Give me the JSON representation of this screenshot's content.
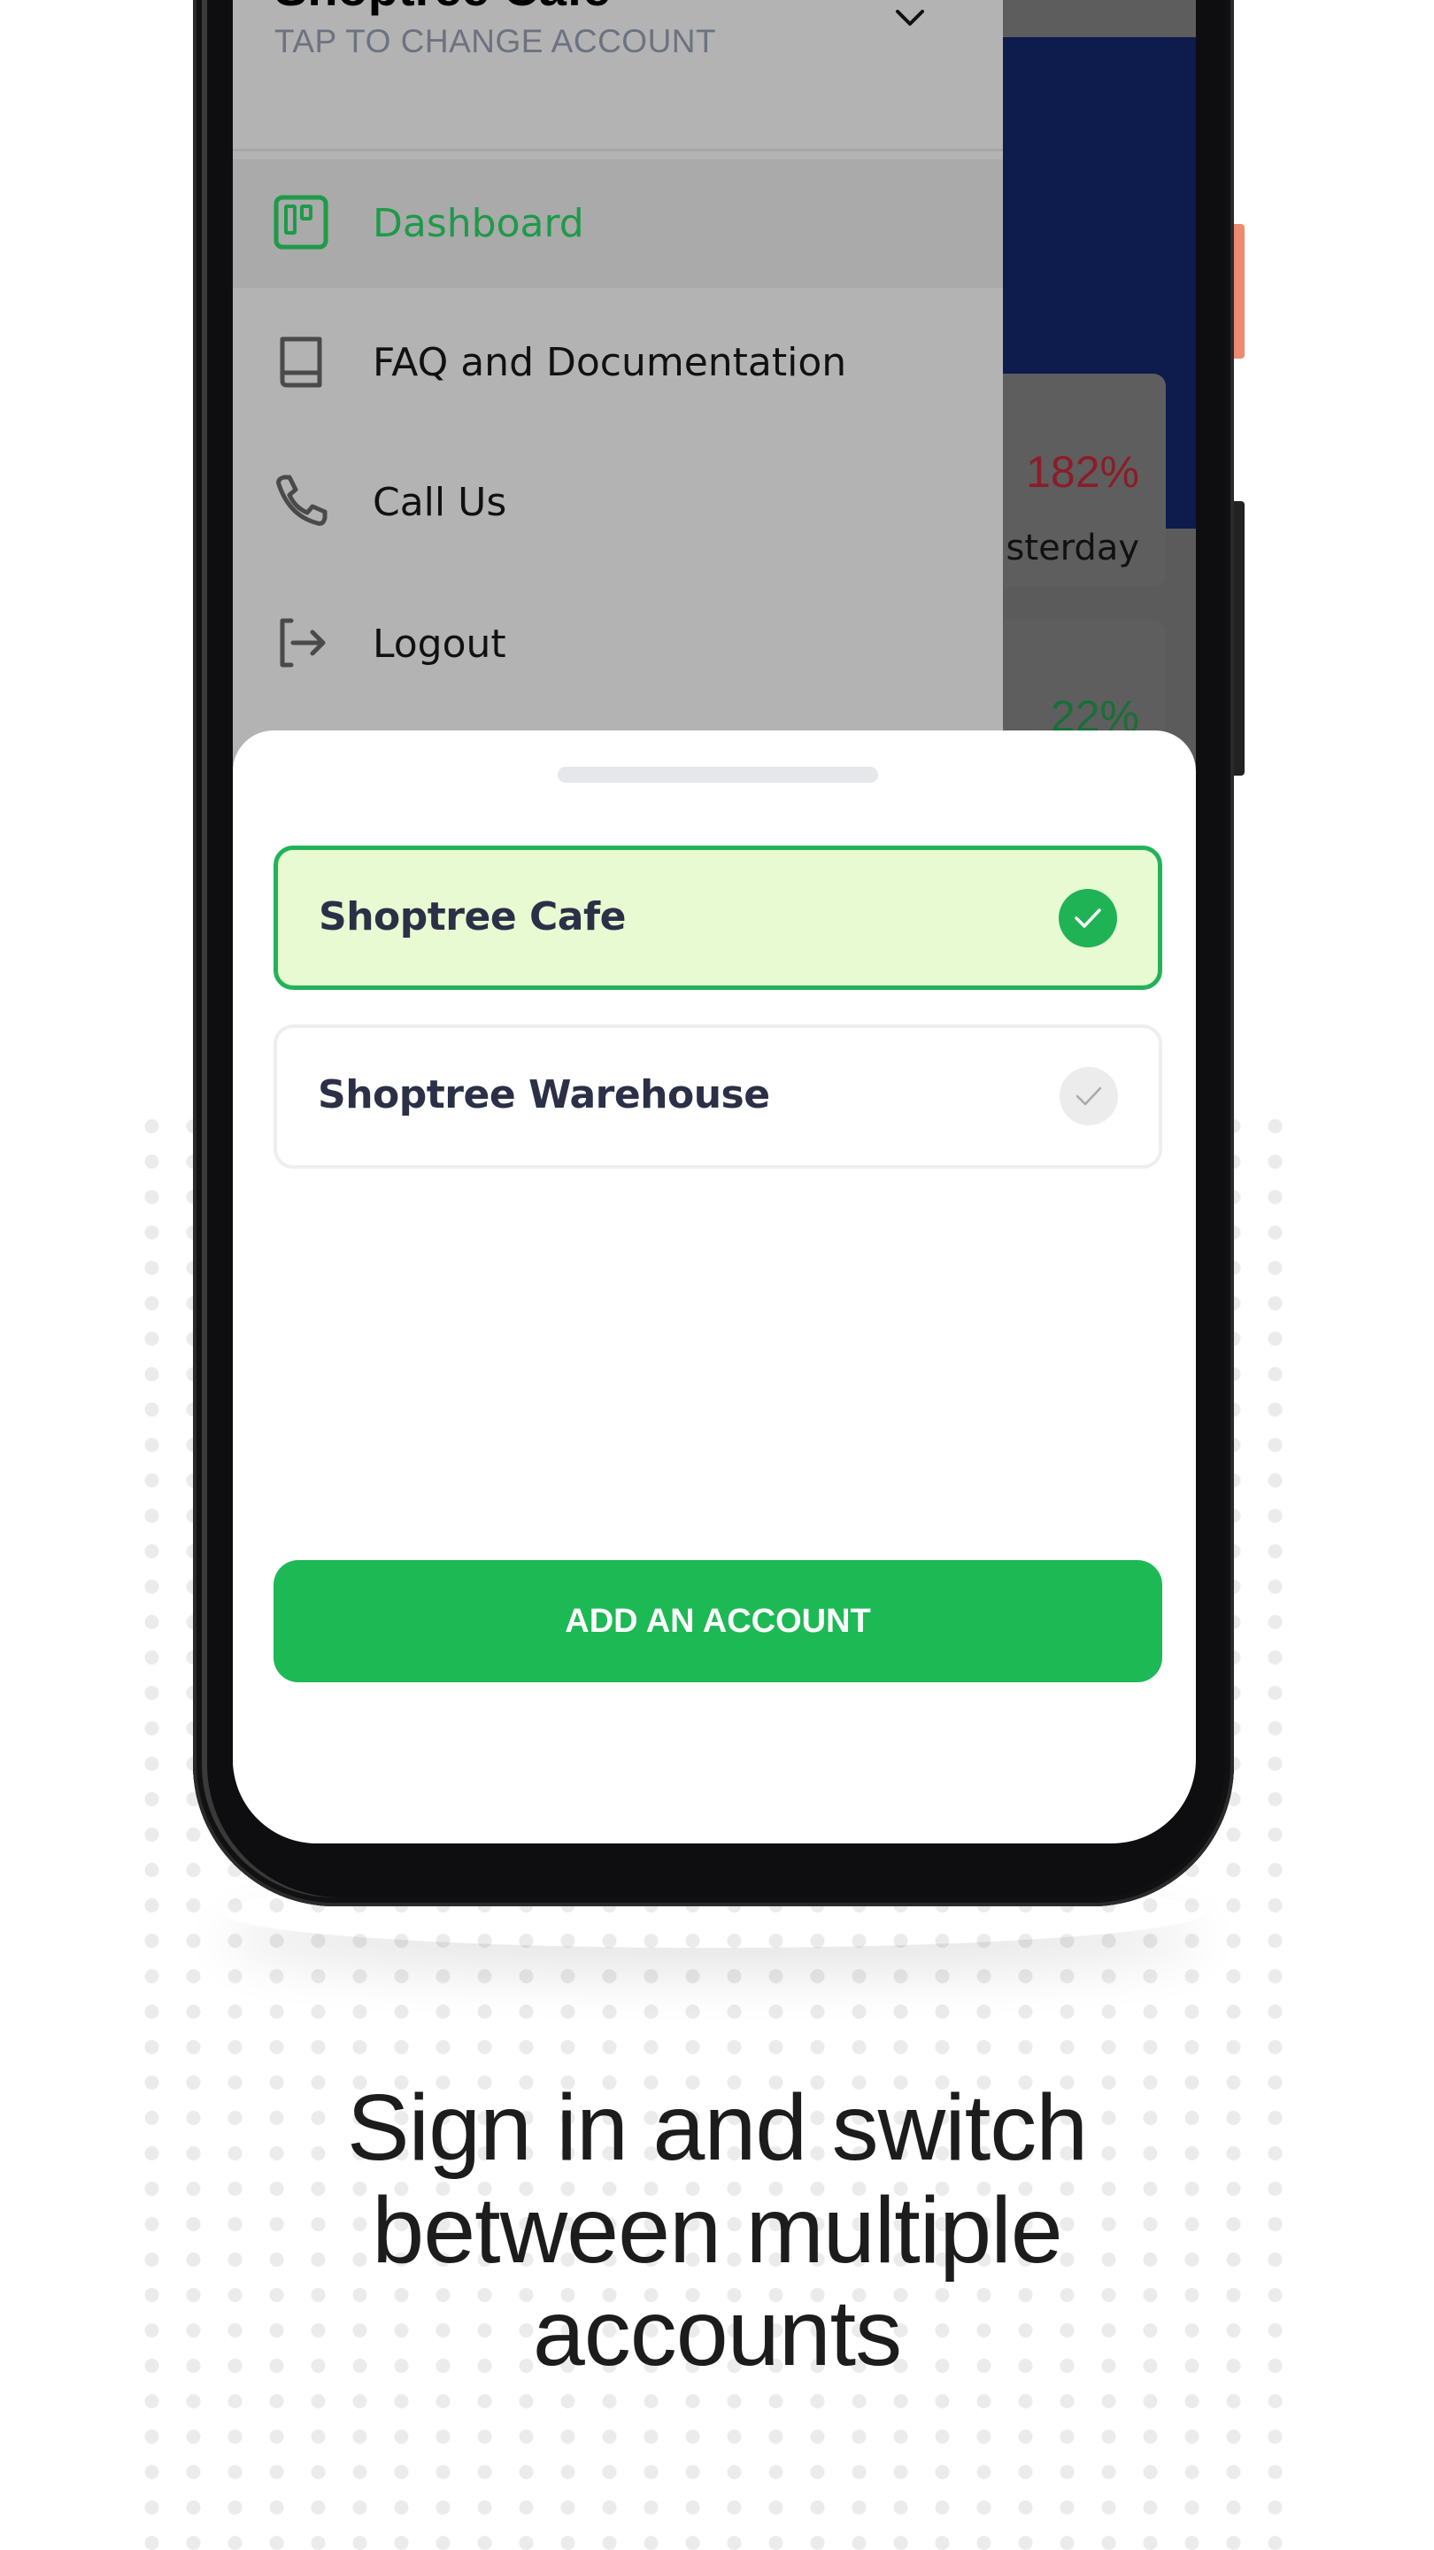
{
  "drawer": {
    "account_name": "Shoptree Cafe",
    "account_subtitle": "TAP TO CHANGE ACCOUNT",
    "menu": [
      {
        "label": "Dashboard",
        "icon": "dashboard-icon",
        "active": true
      },
      {
        "label": "FAQ and Documentation",
        "icon": "book-icon",
        "active": false
      },
      {
        "label": "Call Us",
        "icon": "phone-icon",
        "active": false
      },
      {
        "label": "Logout",
        "icon": "logout-icon",
        "active": false
      }
    ]
  },
  "background_app": {
    "card1": {
      "change": "182%",
      "caption": "sterday"
    },
    "card2": {
      "change": "22%"
    }
  },
  "account_sheet": {
    "accounts": [
      {
        "name": "Shoptree Cafe",
        "selected": true
      },
      {
        "name": "Shoptree Warehouse",
        "selected": false
      }
    ],
    "add_button_label": "ADD AN ACCOUNT"
  },
  "headline": {
    "lines": [
      "Sign in and switch",
      "between multiple",
      "accounts"
    ]
  },
  "colors": {
    "accent_green": "#1db954",
    "selected_bg": "#e8fad2",
    "navy": "#0d1b4d",
    "negative_red": "#8b1d28",
    "positive_green": "#1b6e38"
  }
}
